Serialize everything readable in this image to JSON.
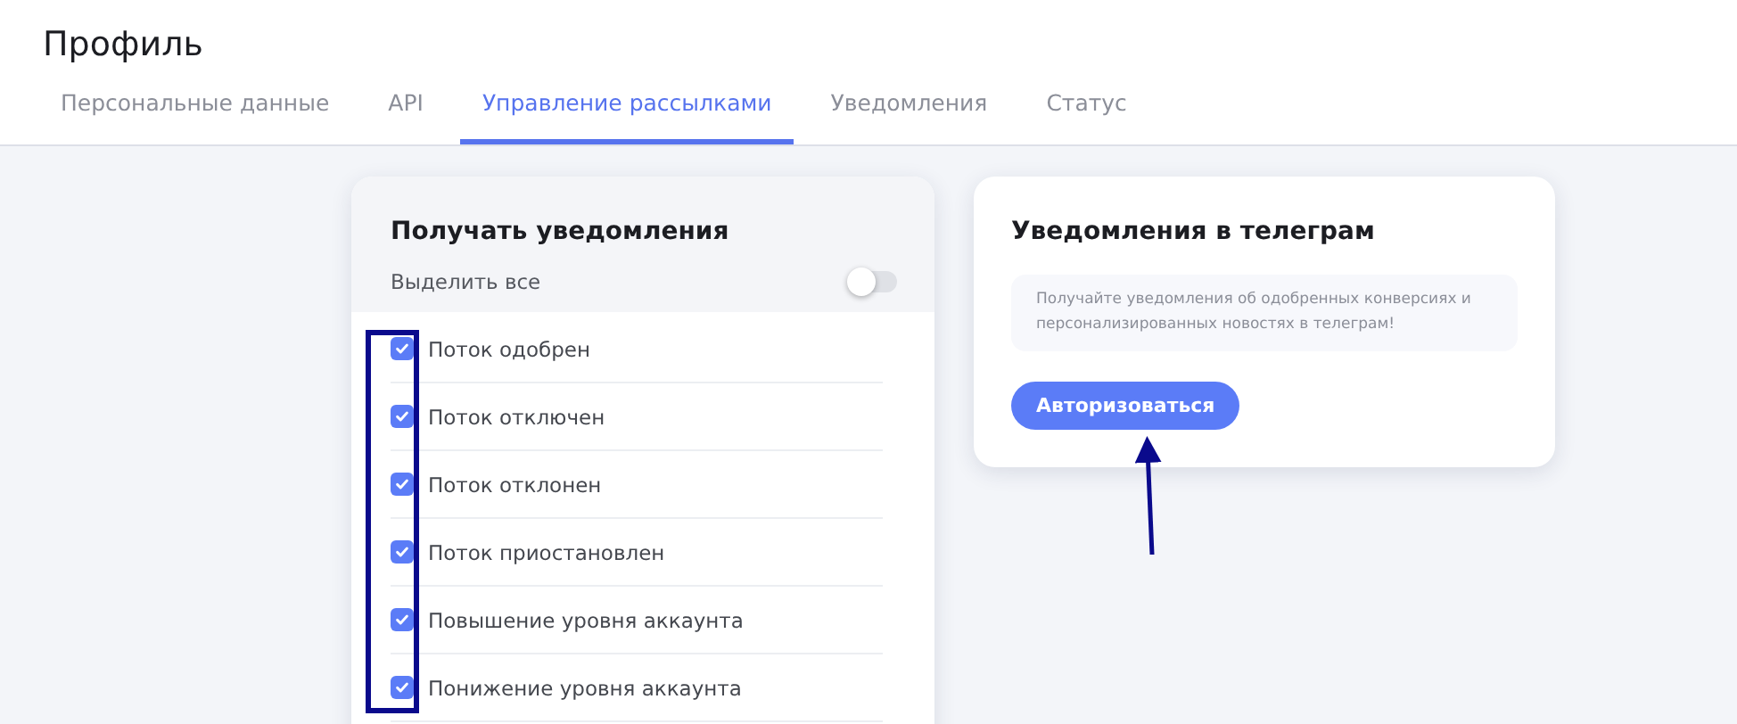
{
  "page_title": "Профиль",
  "tabs": [
    {
      "label": "Персональные данные",
      "selected": false
    },
    {
      "label": "API",
      "selected": false
    },
    {
      "label": "Управление рассылками",
      "selected": true
    },
    {
      "label": "Уведомления",
      "selected": false
    },
    {
      "label": "Статус",
      "selected": false
    }
  ],
  "notifications_card": {
    "title": "Получать уведомления",
    "select_all": {
      "label": "Выделить все",
      "on": false
    },
    "items": [
      {
        "label": "Поток одобрен",
        "checked": true
      },
      {
        "label": "Поток отключен",
        "checked": true
      },
      {
        "label": "Поток отклонен",
        "checked": true
      },
      {
        "label": "Поток приостановлен",
        "checked": true
      },
      {
        "label": "Повышение уровня аккаунта",
        "checked": true
      },
      {
        "label": "Понижение уровня аккаунта",
        "checked": true
      }
    ]
  },
  "telegram_card": {
    "title": "Уведомления в телеграм",
    "info": "Получайте уведомления об одобренных конверсиях и персонализированных новостях в телеграм!",
    "button": "Авторизоваться"
  },
  "annotations": {
    "highlight_box": true,
    "arrow": true
  }
}
